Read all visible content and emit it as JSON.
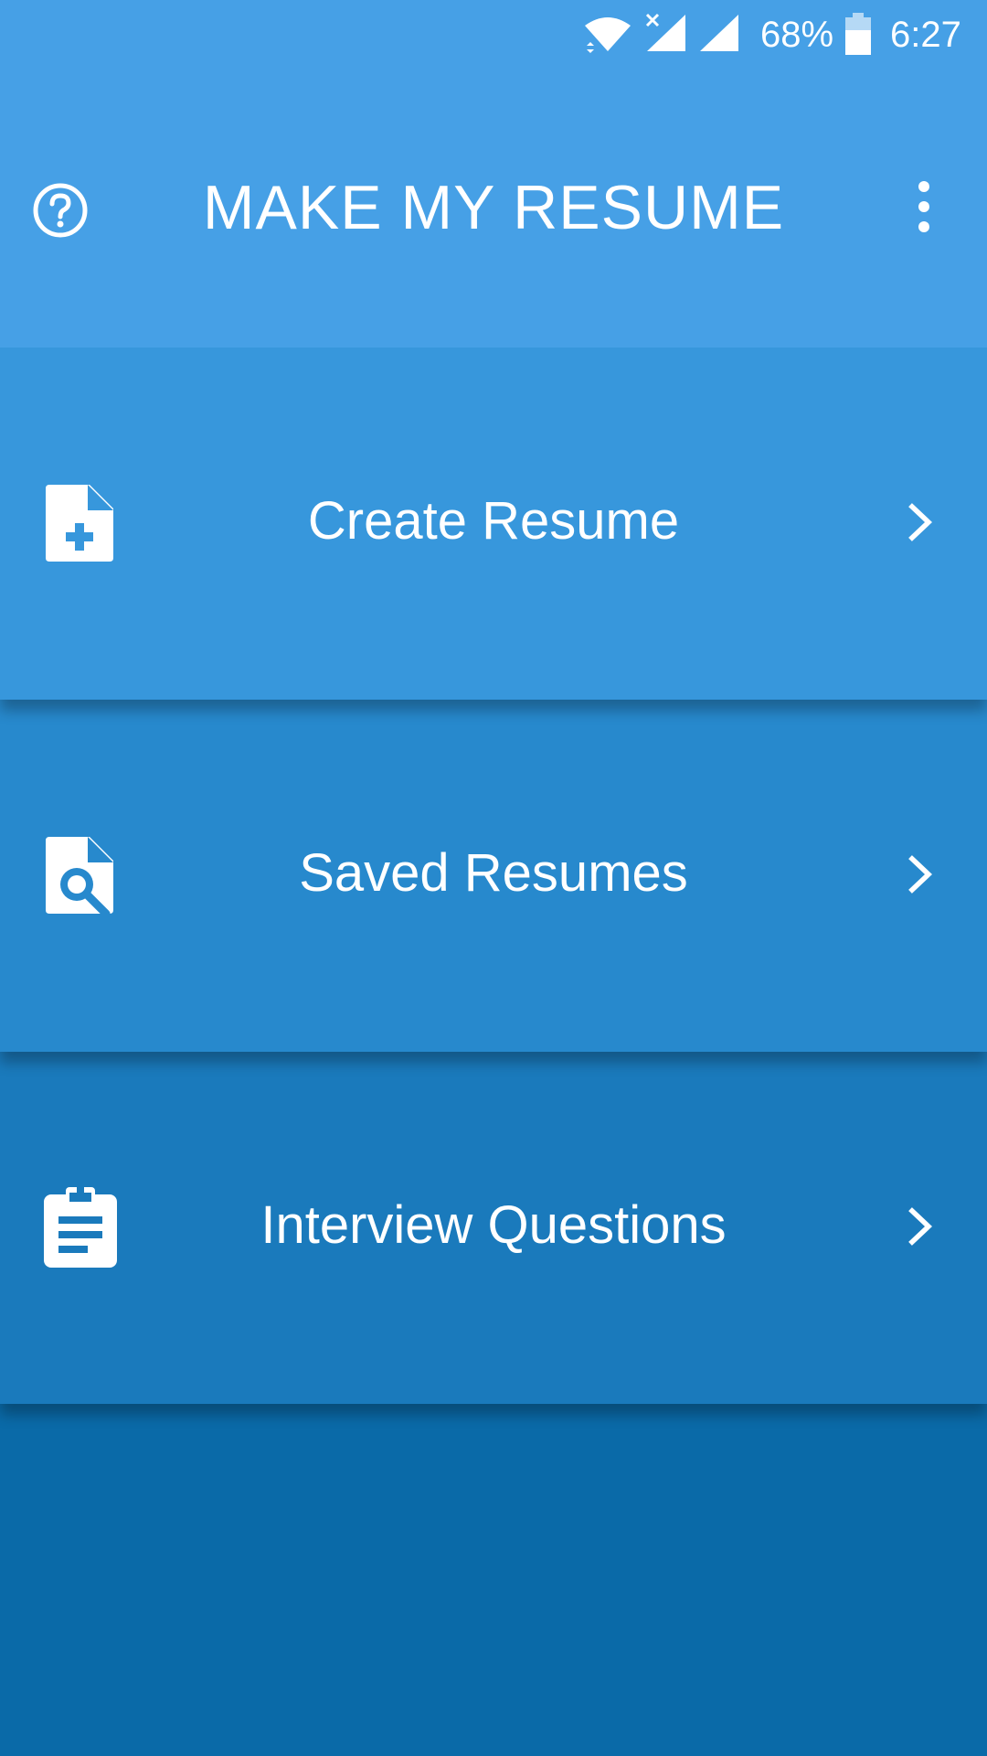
{
  "status_bar": {
    "battery_percent": "68%",
    "time": "6:27",
    "icons": [
      "wifi-icon",
      "signal-no-service-icon",
      "signal-icon",
      "battery-icon"
    ]
  },
  "header": {
    "title": "MAKE MY RESUME",
    "left_icon": "help-icon",
    "right_icon": "more-vert-icon"
  },
  "menu": {
    "items": [
      {
        "label": "Create Resume",
        "icon": "note-add-icon"
      },
      {
        "label": "Saved Resumes",
        "icon": "find-in-page-icon"
      },
      {
        "label": "Interview Questions",
        "icon": "assignment-icon"
      }
    ]
  },
  "colors": {
    "header": "#46a0e6",
    "item1": "#3797dc",
    "item2": "#2789cd",
    "item3": "#1a7abc",
    "bottom": "#0a6aa8",
    "text": "#ffffff"
  }
}
